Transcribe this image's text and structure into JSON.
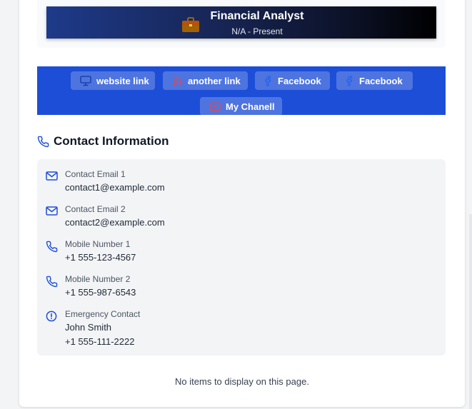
{
  "experience": {
    "title": "Financial Analyst",
    "period": "N/A - Present"
  },
  "links": [
    {
      "label": "website link",
      "icon": "monitor-icon"
    },
    {
      "label": "another link",
      "icon": "rss-icon"
    },
    {
      "label": "Facebook",
      "icon": "facebook-icon"
    },
    {
      "label": "Facebook",
      "icon": "facebook-icon"
    },
    {
      "label": "My Chanell",
      "icon": "youtube-icon"
    }
  ],
  "contact": {
    "heading": "Contact Information",
    "items": [
      {
        "label": "Contact Email 1",
        "value": "contact1@example.com",
        "icon": "mail-icon"
      },
      {
        "label": "Contact Email 2",
        "value": "contact2@example.com",
        "icon": "mail-icon"
      },
      {
        "label": "Mobile Number 1",
        "value": "+1 555-123-4567",
        "icon": "phone-icon"
      },
      {
        "label": "Mobile Number 2",
        "value": "+1 555-987-6543",
        "icon": "phone-icon"
      },
      {
        "label": "Emergency Contact",
        "value": "John Smith",
        "value2": "+1 555-111-2222",
        "icon": "alert-circle-icon"
      }
    ]
  },
  "empty_message": "No items to display on this page.",
  "colors": {
    "links_bar": "#1d4ed8",
    "accent": "#1d4ed8",
    "rss": "#ef4444",
    "youtube": "#ef4444"
  }
}
